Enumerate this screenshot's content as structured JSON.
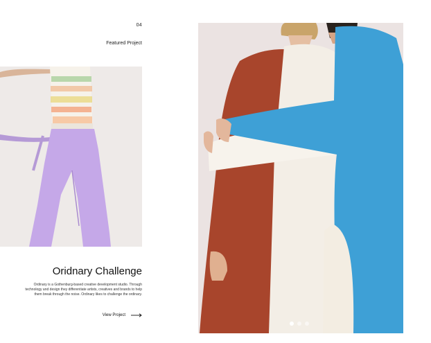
{
  "project": {
    "index": "04",
    "label": "Featured Project",
    "title": "Oridnary Challenge",
    "description": "Ordinary is a Gothenburg-based creative development studio. Through technology and design they differentiate artists, creatives and brands to help them break through the noise. Ordinary likes to challenge the ordinary.",
    "link_label": "View Project"
  },
  "slider": {
    "active_index": 0,
    "count": 3
  },
  "icons": {
    "link_arrow": "arrow-right-icon"
  },
  "colors": {
    "background": "#ffffff",
    "text": "#111111",
    "left_photo_bg": "#eeeae8",
    "right_photo_bg": "#ebe3e2",
    "pants": "#c5a8e8",
    "rust_dress": "#a8452c",
    "cream_dress": "#f3eee6",
    "blue_shirt": "#3ea0d6"
  }
}
